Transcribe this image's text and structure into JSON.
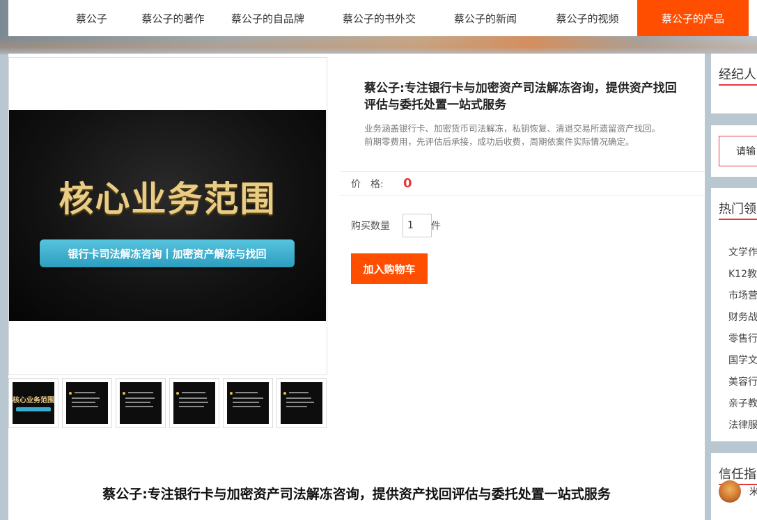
{
  "nav": {
    "items": [
      {
        "label": "蔡公子",
        "active": false
      },
      {
        "label": "蔡公子的著作",
        "active": false
      },
      {
        "label": "蔡公子的自品牌",
        "active": false
      },
      {
        "label": "蔡公子的书外交",
        "active": false
      },
      {
        "label": "蔡公子的新闻",
        "active": false
      },
      {
        "label": "蔡公子的视频",
        "active": false
      },
      {
        "label": "蔡公子的产品",
        "active": true
      }
    ]
  },
  "gallery": {
    "banner_title": "核心业务范围",
    "banner_subtitle": "银行卡司法解冻咨询丨加密资产解冻与找回",
    "thumb_count": 6
  },
  "product": {
    "title": "蔡公子:专注银行卡与加密资产司法解冻咨询，提供资产找回评估与委托处置一站式服务",
    "description_lines": [
      "业务涵盖银行卡、加密货币司法解冻，私钥恢复、清退交易所遗留资产找回。",
      "前期零费用，先评估后承接，成功后收费，周期依案件实际情况确定。"
    ],
    "price_label": "价　格:",
    "price_value": "0",
    "quantity_label": "购买数量",
    "quantity_value": "1",
    "quantity_unit": "件",
    "add_to_cart_label": "加入购物车"
  },
  "footer_title": "蔡公子:专注银行卡与加密资产司法解冻咨询，提供资产找回评估与委托处置一站式服务",
  "sidebar": {
    "agent_heading": "经纪人",
    "search_text": "请输",
    "hot_heading": "热门领",
    "hot_items": [
      "文学作",
      "K12教",
      "市场营",
      "财务战",
      "零售行",
      "国学文",
      "美容行",
      "亲子教",
      "法律服"
    ],
    "trust_heading": "信任指",
    "trust_name": "米"
  },
  "colors": {
    "accent": "#ff4e00",
    "price": "#e4393c"
  }
}
